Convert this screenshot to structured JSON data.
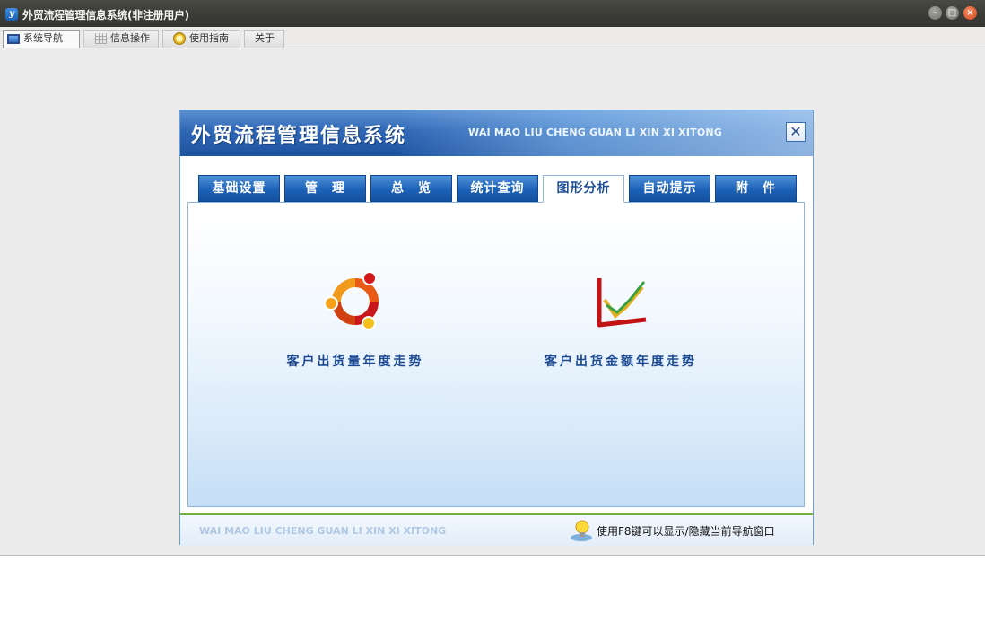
{
  "window": {
    "title": "外贸流程管理信息系统(非注册用户)",
    "app_icon_letter": "y"
  },
  "top_tabs": [
    {
      "label": "系统导航",
      "icon": "monitor-icon",
      "active": true
    },
    {
      "label": "信息操作",
      "icon": "grid-icon",
      "active": false
    },
    {
      "label": "使用指南",
      "icon": "clock-icon",
      "active": false
    },
    {
      "label": "关于",
      "icon": "",
      "active": false
    }
  ],
  "navigator": {
    "title": "外贸流程管理信息系统",
    "subtitle": "WAI MAO LIU CHENG GUAN LI XIN XI XITONG",
    "close_glyph": "✕",
    "tabs": [
      {
        "label": "基础设置",
        "active": false
      },
      {
        "label": "管　理",
        "active": false
      },
      {
        "label": "总　览",
        "active": false
      },
      {
        "label": "统计查询",
        "active": false
      },
      {
        "label": "图形分析",
        "active": true
      },
      {
        "label": "自动提示",
        "active": false
      },
      {
        "label": "附　件",
        "active": false
      }
    ],
    "features": [
      {
        "label": "客户出货量年度走势",
        "icon": "ring-chart-icon"
      },
      {
        "label": "客户出货金额年度走势",
        "icon": "line-chart-icon"
      }
    ],
    "footer": {
      "subtitle": "WAI MAO LIU CHENG GUAN LI XIN XI XITONG",
      "hint": "使用F8键可以显示/隐藏当前导航窗口",
      "hint_icon": "lightbulb-icon"
    }
  },
  "colors": {
    "header_blue": "#1f53a0",
    "tab_blue": "#1c62b8",
    "accent_green": "#6cb33f",
    "close_red": "#d6461e"
  }
}
